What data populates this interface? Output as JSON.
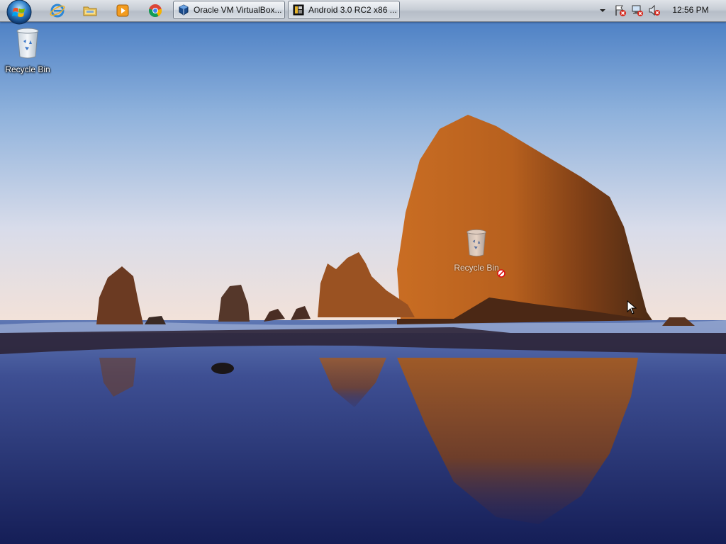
{
  "taskbar": {
    "start_button": "start-orb",
    "pinned": [
      {
        "name": "internet-explorer",
        "icon": "ie-icon"
      },
      {
        "name": "windows-explorer",
        "icon": "folder-icon"
      },
      {
        "name": "media-player",
        "icon": "media-player-icon"
      },
      {
        "name": "chrome",
        "icon": "chrome-icon"
      }
    ],
    "tasks": [
      {
        "label": "Oracle VM VirtualBox...",
        "icon": "virtualbox-icon"
      },
      {
        "label": "Android 3.0 RC2 x86 ...",
        "icon": "vm-window-icon"
      }
    ],
    "tray": {
      "icons": [
        "show-hidden-icons-chevron",
        "action-center-alert-icon",
        "network-error-icon",
        "volume-muted-icon"
      ],
      "clock": "12:56 PM"
    }
  },
  "desktop": {
    "icons": [
      {
        "label": "Recycle Bin",
        "icon": "recycle-bin-icon"
      }
    ],
    "drag_ghost": {
      "label": "Recycle Bin",
      "icon": "recycle-bin-icon",
      "state": "no-drop"
    }
  },
  "colors": {
    "sky_top": "#4e83c9",
    "sky_horizon": "#f1e3db",
    "rock": "#b8621f",
    "sea": "#1f2c6a"
  }
}
